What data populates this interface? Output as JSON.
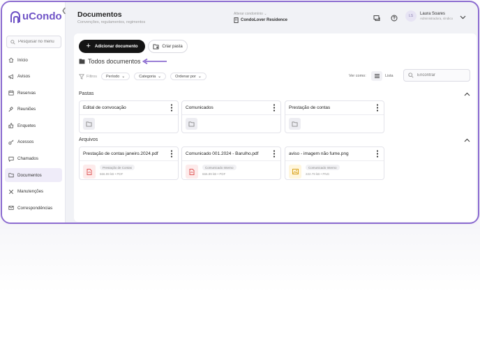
{
  "sidebar": {
    "brand": "uCondo",
    "search_placeholder": "Pesquisar no menu",
    "items": [
      {
        "label": "Início",
        "icon": "home-icon"
      },
      {
        "label": "Avisos",
        "icon": "megaphone-icon"
      },
      {
        "label": "Reservas",
        "icon": "calendar-icon"
      },
      {
        "label": "Reuniões",
        "icon": "gavel-icon"
      },
      {
        "label": "Enquetes",
        "icon": "thumbs-up-icon"
      },
      {
        "label": "Acessos",
        "icon": "key-icon"
      },
      {
        "label": "Chamados",
        "icon": "chat-icon"
      },
      {
        "label": "Documentos",
        "icon": "folder-icon",
        "active": true
      },
      {
        "label": "Manutenções",
        "icon": "tools-icon"
      },
      {
        "label": "Correspondências",
        "icon": "mail-icon"
      }
    ]
  },
  "header": {
    "title": "Documentos",
    "subtitle": "Convenções, regulamentos, regimentos",
    "condo_switch_label": "Alterar condomínio",
    "condo_name": "CondoLover Residence",
    "user_initials": "LS",
    "user_name": "Laura Soares",
    "user_role": "Administradora, síndico"
  },
  "toolbar": {
    "add_label": "Adicionar documento",
    "folder_label": "Criar pasta"
  },
  "breadcrumb": {
    "label": "Todos documentos"
  },
  "filters": {
    "label": "Filtros",
    "chips": [
      "Período",
      "Categoria",
      "Ordenar por"
    ],
    "view_label": "Ver como:",
    "list_label": "Lista",
    "search_placeholder": "Encontrar"
  },
  "folders": {
    "title": "Pastas",
    "items": [
      "Edital de convocação",
      "Comunicados",
      "Prestação de contas"
    ]
  },
  "files": {
    "title": "Arquivos",
    "items": [
      {
        "name": "Prestação de contas janeiro.2024.pdf",
        "tag": "Prestação de Contas",
        "meta": "666.99 kB • PDF",
        "type": "pdf"
      },
      {
        "name": "Comunicado 001.2024 - Barulho.pdf",
        "tag": "Comunicado Interno",
        "meta": "666.89 kB • PDF",
        "type": "pdf"
      },
      {
        "name": "aviso - imagem não fume.png",
        "tag": "Comunicado Interno",
        "meta": "222.79 kB • PNG",
        "type": "png"
      }
    ]
  },
  "colors": {
    "accent": "#6f53c6",
    "frame": "#8c6cd0",
    "pdf": "#e05a5a",
    "png": "#d9a21b"
  }
}
